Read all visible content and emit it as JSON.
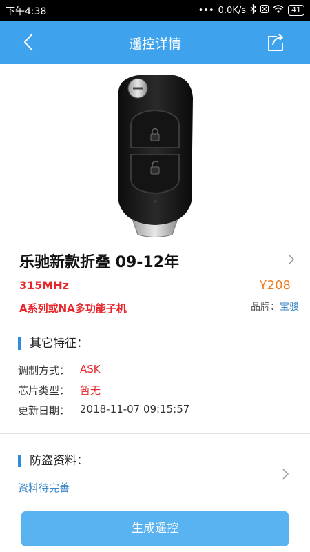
{
  "status": {
    "time": "下午4:38",
    "dots": "•••",
    "net_speed": "0.0K/s",
    "battery": "41"
  },
  "header": {
    "title": "遥控详情"
  },
  "product": {
    "name": "乐驰新款折叠 09-12年",
    "frequency": "315MHz",
    "price": "¥208",
    "type": "A系列或NA多功能子机",
    "brand_label": "品牌：",
    "brand_value": "宝骏"
  },
  "features": {
    "title": "其它特征：",
    "rows": [
      {
        "label": "调制方式：",
        "value": "ASK",
        "color": "#e8262b"
      },
      {
        "label": "芯片类型：",
        "value": "暂无",
        "color": "#e8262b"
      },
      {
        "label": "更新日期：",
        "value": "2018-11-07 09:15:57",
        "color": "#333333"
      }
    ]
  },
  "anti_theft": {
    "title": "防盗资料：",
    "link": "资料待完善"
  },
  "actions": {
    "generate_label": "生成遥控"
  },
  "colors": {
    "appbar": "#3ea3ec",
    "accent_red": "#e8262b",
    "price_orange": "#f07c22",
    "link_blue": "#3b86c9",
    "button": "#5ab3f1"
  }
}
